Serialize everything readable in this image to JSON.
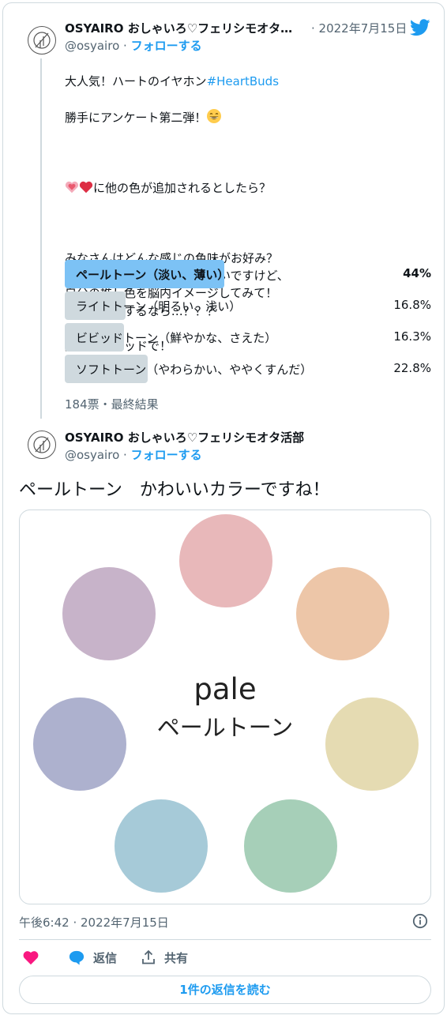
{
  "tweet1": {
    "name": "OSYAIRO おしゃいろ♡フェリシモオタ…",
    "handle": "@osyairo",
    "follow_label": "フォローする",
    "date": "2022年7月15日",
    "text_line1": "大人気！ハートのイヤホン",
    "hashtag": "#HeartBuds",
    "text_line2": "勝手にアンケート第二弾！",
    "text_line3": "に他の色が追加されるとしたら？",
    "text_body": "みなさんはどんな感じの色味がお好み？\n見本がそのまんまの色ではないですけど、\n自分の推し色を脳内イメージしてみて！\nイヤホンにするなら…？？？\n\n見本はスレッドで！",
    "poll": [
      {
        "label": "ペールトーン（淡い、薄い）",
        "percent": "44%",
        "value": 44,
        "winner": true
      },
      {
        "label": "ライトトーン（明るい、浅い）",
        "percent": "16.8%",
        "value": 16.8,
        "winner": false
      },
      {
        "label": "ビビッドトーン（鮮やかな、さえた）",
        "percent": "16.3%",
        "value": 16.3,
        "winner": false
      },
      {
        "label": "ソフトトーン（やわらかい、ややくすんだ）",
        "percent": "22.8%",
        "value": 22.8,
        "winner": false
      }
    ],
    "poll_meta": "184票・最終結果"
  },
  "tweet2": {
    "name": "OSYAIRO おしゃいろ♡フェリシモオタ活部",
    "handle": "@osyairo",
    "follow_label": "フォローする",
    "text": "ペールトーン　かわいいカラーですね！",
    "image_title": "pale",
    "image_subtitle": "ペールトーン",
    "swatch_colors": [
      "#e8b8ba",
      "#edc6a8",
      "#e5dbb2",
      "#a6cfb8",
      "#a6cad8",
      "#adb1ce",
      "#c7b3c9"
    ],
    "timestamp": "午後6:42 · 2022年7月15日",
    "actions": {
      "reply": "返信",
      "share": "共有"
    },
    "read_replies": "1件の返信を読む"
  },
  "colors": {
    "accent": "#1d9bf0",
    "poll_winner": "#7cc2f5",
    "poll_other": "#cfd9de",
    "like": "#f91880"
  }
}
